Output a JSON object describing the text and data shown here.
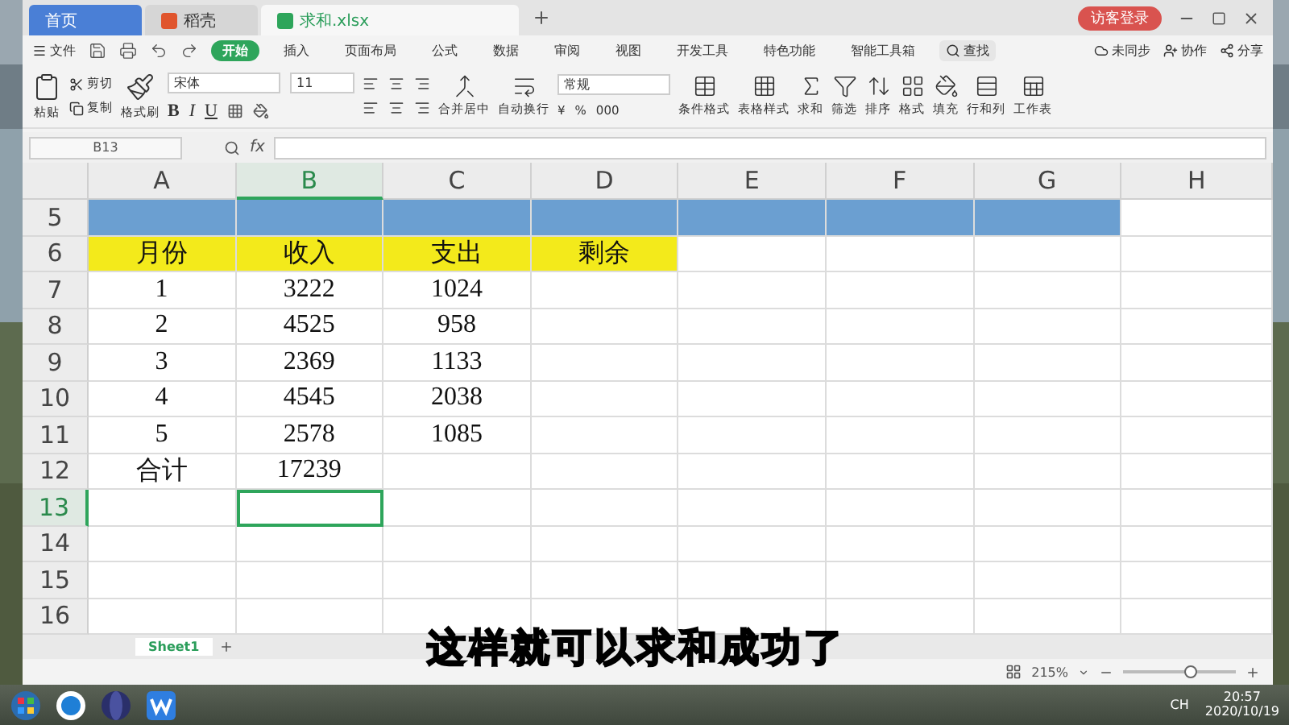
{
  "tabs": [
    {
      "label": "首页",
      "kind": "home",
      "selected": false
    },
    {
      "label": "稻壳",
      "kind": "docer",
      "selected": false
    },
    {
      "label": "求和.xlsx",
      "kind": "sheet",
      "selected": true
    }
  ],
  "login": "访客登录",
  "menu": {
    "file": "文件",
    "items": [
      {
        "label": "开始",
        "selected": true
      },
      {
        "label": "插入",
        "selected": false
      },
      {
        "label": "页面布局",
        "selected": false
      },
      {
        "label": "公式",
        "selected": false
      },
      {
        "label": "数据",
        "selected": false
      },
      {
        "label": "审阅",
        "selected": false
      },
      {
        "label": "视图",
        "selected": false
      },
      {
        "label": "开发工具",
        "selected": false
      },
      {
        "label": "特色功能",
        "selected": false
      },
      {
        "label": "智能工具箱",
        "selected": false
      }
    ],
    "search": "查找",
    "right": [
      "未同步",
      "协作",
      "分享"
    ]
  },
  "ribbon": {
    "paste": "粘贴",
    "cut": "剪切",
    "copy": "复制",
    "format_painter": "格式刷",
    "font": "宋体",
    "size": "11",
    "bold": "B",
    "italic": "I",
    "underline": "U",
    "merge": "合并居中",
    "wrap": "自动换行",
    "number_format": "常规",
    "currency": "¥",
    "percent": "%",
    "thousands": "000",
    "tools": [
      "条件格式",
      "表格样式",
      "求和",
      "筛选",
      "排序",
      "格式",
      "填充",
      "行和列",
      "工作表"
    ]
  },
  "name_box": "B13",
  "fx": "fx",
  "columns": [
    {
      "label": "A",
      "selected": false
    },
    {
      "label": "B",
      "selected": true
    },
    {
      "label": "C",
      "selected": false
    },
    {
      "label": "D",
      "selected": false
    },
    {
      "label": "E",
      "selected": false
    },
    {
      "label": "F",
      "selected": false
    },
    {
      "label": "G",
      "selected": false
    },
    {
      "label": "H",
      "selected": false
    }
  ],
  "rows": [
    {
      "number": "5",
      "selected": false,
      "cells": [
        {
          "color": "#6b9fd1"
        },
        {
          "color": "#6b9fd1"
        },
        {
          "color": "#6b9fd1"
        },
        {
          "color": "#6b9fd1"
        },
        {
          "color": "#6b9fd1"
        },
        {
          "color": "#6b9fd1"
        },
        {
          "color": "#6b9fd1"
        }
      ]
    },
    {
      "number": "6",
      "selected": false,
      "cells": [
        {
          "text": "月份",
          "color": "#f3ea1b"
        },
        {
          "text": "收入",
          "color": "#f3ea1b"
        },
        {
          "text": "支出",
          "color": "#f3ea1b"
        },
        {
          "text": "剩余",
          "color": "#f3ea1b"
        }
      ]
    },
    {
      "number": "7",
      "selected": false,
      "cells": [
        {
          "text": "1"
        },
        {
          "text": "3222"
        },
        {
          "text": "1024"
        }
      ]
    },
    {
      "number": "8",
      "selected": false,
      "cells": [
        {
          "text": "2"
        },
        {
          "text": "4525"
        },
        {
          "text": "958"
        }
      ]
    },
    {
      "number": "9",
      "selected": false,
      "cells": [
        {
          "text": "3"
        },
        {
          "text": "2369"
        },
        {
          "text": "1133"
        }
      ]
    },
    {
      "number": "10",
      "selected": false,
      "cells": [
        {
          "text": "4"
        },
        {
          "text": "4545"
        },
        {
          "text": "2038"
        }
      ]
    },
    {
      "number": "11",
      "selected": false,
      "cells": [
        {
          "text": "5"
        },
        {
          "text": "2578"
        },
        {
          "text": "1085"
        }
      ]
    },
    {
      "number": "12",
      "selected": false,
      "cells": [
        {
          "text": "合计"
        },
        {
          "text": "17239"
        }
      ]
    },
    {
      "number": "13",
      "selected": true,
      "cells": []
    },
    {
      "number": "14",
      "selected": false,
      "cells": []
    },
    {
      "number": "15",
      "selected": false,
      "cells": []
    },
    {
      "number": "16",
      "selected": false,
      "cells": []
    }
  ],
  "sheets": [
    {
      "label": "Sheet1",
      "selected": true
    }
  ],
  "zoom": "215%",
  "zoom_slider": {
    "level": 0.6
  },
  "subtitle": "这样就可以求和成功了",
  "tray": {
    "lang": "CH",
    "time": "20:57",
    "date": "2020/10/19"
  }
}
